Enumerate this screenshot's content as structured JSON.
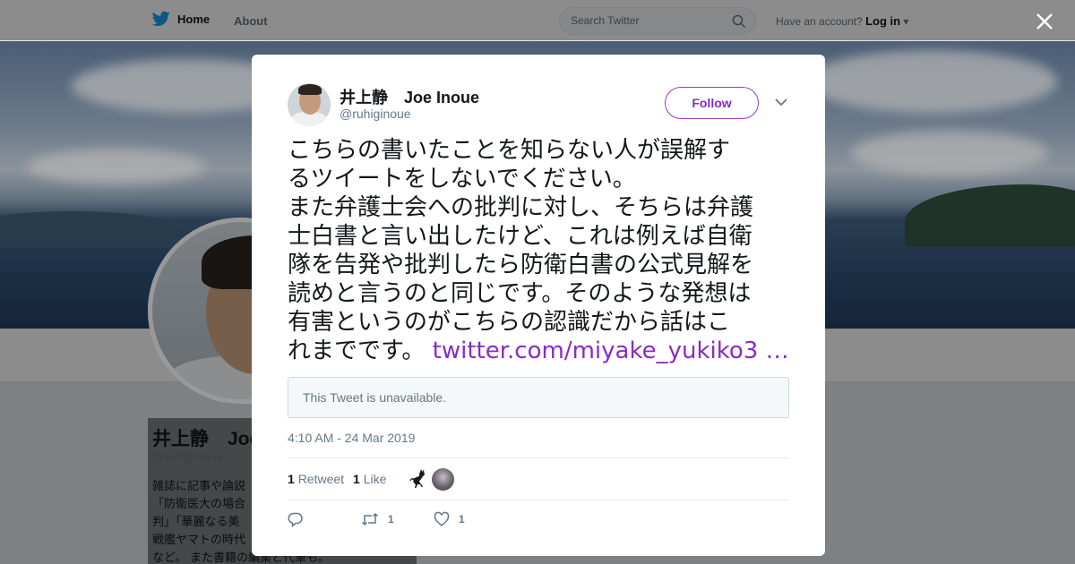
{
  "nav": {
    "home_label": "Home",
    "about_label": "About",
    "search_placeholder": "Search Twitter",
    "account_prompt": "Have an account?",
    "login_label": "Log in"
  },
  "profile": {
    "name": "井上静　Joe",
    "handle": "@ruhiginoue",
    "bio_lines": [
      "雑誌に記事や論説",
      "「防衛医大の場合",
      "判」「華麗なる美",
      "戦艦ヤマトの時代",
      "など。 また書籍の編集と代筆も。"
    ]
  },
  "tweet": {
    "author_name": "井上静　Joe Inoue",
    "author_handle": "@ruhiginoue",
    "follow_label": "Follow",
    "text_lines": [
      "こちらの書いたことを知らない人が誤解す",
      "るツイートをしないでください。",
      "また弁護士会への批判に対し、そちらは弁護",
      "士白書と言い出したけど、これは例えば自衛",
      "隊を告発や批判したら防衛白書の公式見解を",
      "読めと言うのと同じです。そのような発想は",
      "有害というのがこちらの認識だから話はこ",
      "れまでです。 "
    ],
    "link_text": "twitter.com/miyake_yukiko3 …",
    "quote_unavailable": "This Tweet is unavailable.",
    "timestamp": "4:10 AM - 24 Mar 2019",
    "retweet_count": "1",
    "retweet_label": "Retweet",
    "like_count": "1",
    "like_label": "Like",
    "action_retweet_count": "1",
    "action_like_count": "1"
  },
  "colors": {
    "accent": "#8a2bc4",
    "text_primary": "#14171a",
    "text_secondary": "#657786"
  },
  "icons": [
    "twitter-bird-icon",
    "search-icon",
    "close-icon",
    "chevron-down-icon",
    "reply-icon",
    "retweet-icon",
    "heart-icon"
  ]
}
